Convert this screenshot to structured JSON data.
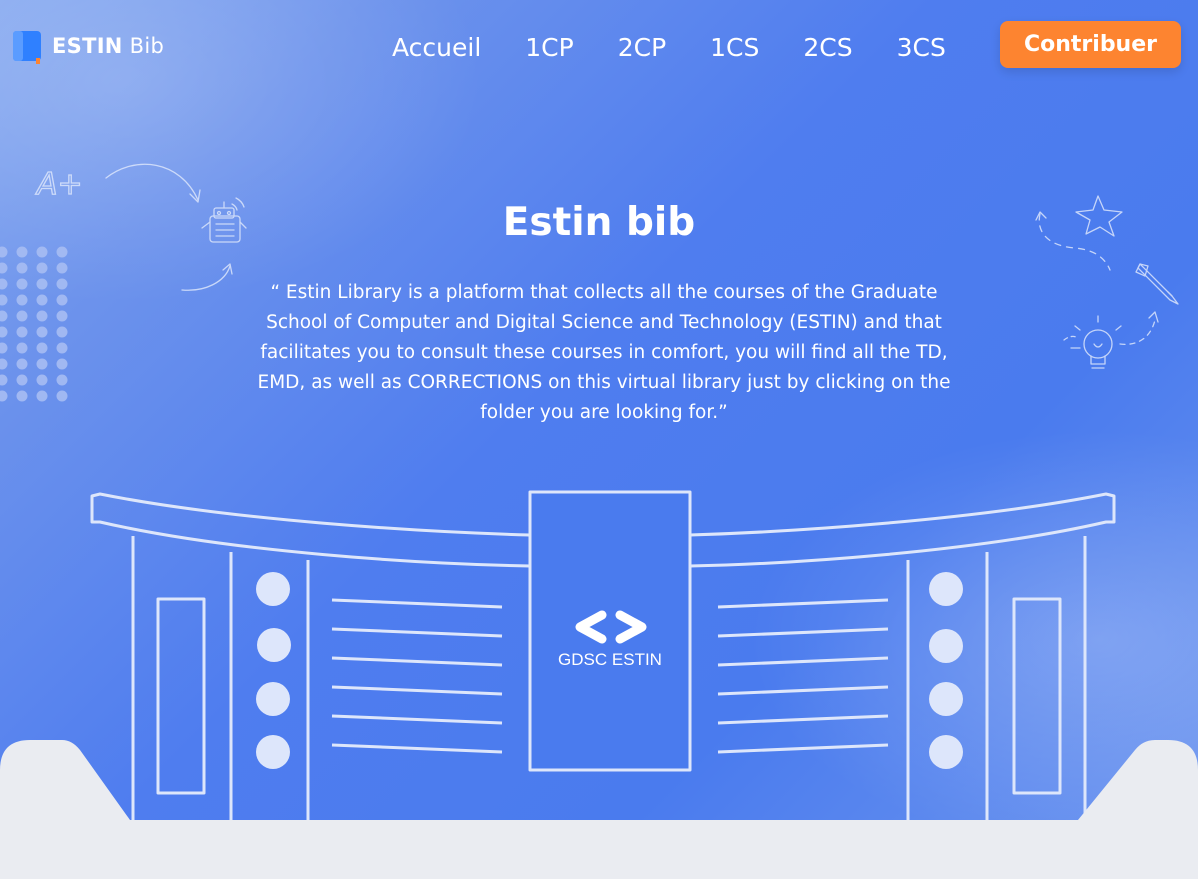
{
  "header": {
    "logo": {
      "brand_bold": "ESTIN",
      "brand_light": "Bib"
    },
    "nav": [
      {
        "label": "Accueil"
      },
      {
        "label": "1CP"
      },
      {
        "label": "2CP"
      },
      {
        "label": "1CS"
      },
      {
        "label": "2CS"
      },
      {
        "label": "3CS"
      }
    ],
    "cta_label": "Contribuer"
  },
  "hero": {
    "title": "Estin bib",
    "description": "“ Estin Library is a platform that collects all the courses of the Graduate School of Computer and Digital Science and Technology (ESTIN) and that facilitates you to consult these courses in comfort, you will find all the TD, EMD, as well as CORRECTIONS on this virtual library just by clicking on the folder you are looking for.”"
  },
  "illustration": {
    "sign_text": "GDSC ESTIN",
    "doodle_text": "A+"
  },
  "colors": {
    "background": "#4f7def",
    "accent": "#fd8430",
    "logo_blue": "#2f80ff",
    "logo_orange": "#fd8430",
    "line": "#dde6fb",
    "ground": "#eaecf1"
  },
  "icons": [
    "book-icon",
    "robot-icon",
    "star-icon",
    "pencil-icon",
    "lightbulb-icon",
    "code-brackets-icon"
  ]
}
